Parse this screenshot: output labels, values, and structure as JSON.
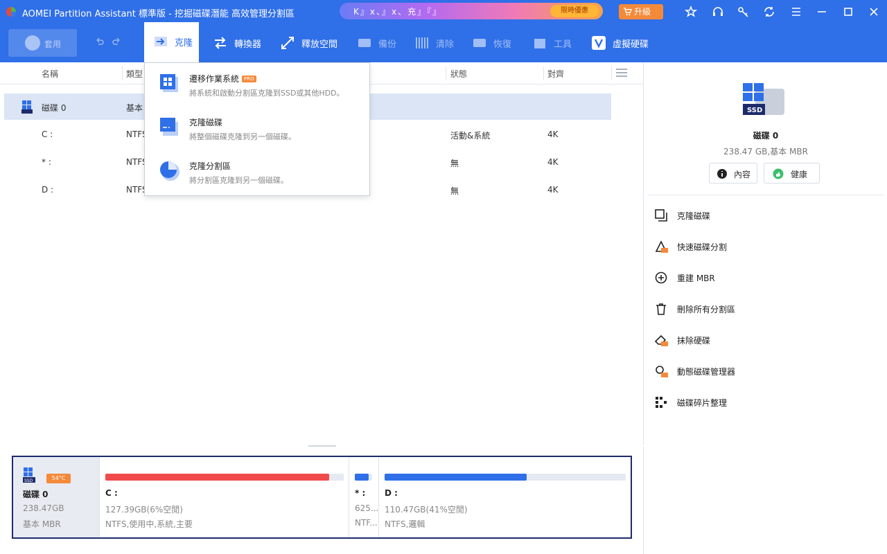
{
  "window": {
    "title": "AOMEI Partition Assistant 標準版 - 挖掘磁碟潛能 高效管理分割區",
    "promo_text": "K』x、』x、充』『』",
    "promo_button": "限時優惠",
    "upgrade_label": "升級"
  },
  "toolbar": {
    "apply_label": "套用",
    "tools": [
      {
        "label": "克隆",
        "active": true
      },
      {
        "label": "轉換器"
      },
      {
        "label": "釋放空間"
      },
      {
        "label": "備份"
      },
      {
        "label": "清除"
      },
      {
        "label": "恢復"
      },
      {
        "label": "工具"
      },
      {
        "label": "虛擬硬碟"
      }
    ]
  },
  "table": {
    "columns": [
      "名稱",
      "類型",
      "狀態",
      "對齊"
    ],
    "rows": [
      {
        "name": "磁碟 0",
        "type": "基本",
        "status": "",
        "align": ""
      },
      {
        "name": "C :",
        "type": "NTFS",
        "status": "活動&系統",
        "align": "4K"
      },
      {
        "name": "* :",
        "type": "NTFS",
        "status": "無",
        "align": "4K"
      },
      {
        "name": "D :",
        "type": "NTFS",
        "status": "無",
        "align": "4K"
      }
    ]
  },
  "clone_menu": {
    "items": [
      {
        "title": "遷移作業系統",
        "desc": "將系統和啟動分割區克隆到SSD或其他HDD。",
        "pro": "PRO"
      },
      {
        "title": "克隆磁碟",
        "desc": "將整個磁碟克隆到另一個磁碟。"
      },
      {
        "title": "克隆分割區",
        "desc": "將分割區克隆到另一個磁碟。"
      }
    ]
  },
  "right_panel": {
    "disk_name": "磁碟 0",
    "disk_info": "238.47 GB,基本 MBR",
    "properties_label": "內容",
    "health_label": "健康",
    "operations": [
      {
        "label": "克隆磁碟",
        "icon": "clone-disk-icon"
      },
      {
        "label": "快速磁碟分割",
        "icon": "quick-partition-icon"
      },
      {
        "label": "重建 MBR",
        "icon": "rebuild-mbr-icon"
      },
      {
        "label": "刪除所有分割區",
        "icon": "trash-icon"
      },
      {
        "label": "抹除硬碟",
        "icon": "eraser-icon"
      },
      {
        "label": "動態磁碟管理器",
        "icon": "dynamic-disk-icon"
      },
      {
        "label": "磁碟碎片整理",
        "icon": "defrag-icon"
      }
    ]
  },
  "disk_map": {
    "disk": {
      "name": "磁碟 0",
      "size": "238.47GB",
      "type": "基本 MBR",
      "ssd": "SSD",
      "temp": "54°C"
    },
    "partitions": [
      {
        "name": "C :",
        "size": "127.39GB(6%空閒)",
        "fs": "NTFS,使用中,系統,主要",
        "used_fraction": 0.94,
        "color": "#f04a4a"
      },
      {
        "name": "* :",
        "size": "625...",
        "fs": "NTF...",
        "used_fraction": 0.8,
        "color": "#2f6fe8"
      },
      {
        "name": "D :",
        "size": "110.47GB(41%空閒)",
        "fs": "NTFS,邏輯",
        "used_fraction": 0.59,
        "color": "#2f6fe8"
      }
    ]
  },
  "colors": {
    "brand": "#2f6fe8",
    "accent": "#f5893a",
    "danger": "#f04a4a",
    "selected_row": "#dbe5f5"
  }
}
